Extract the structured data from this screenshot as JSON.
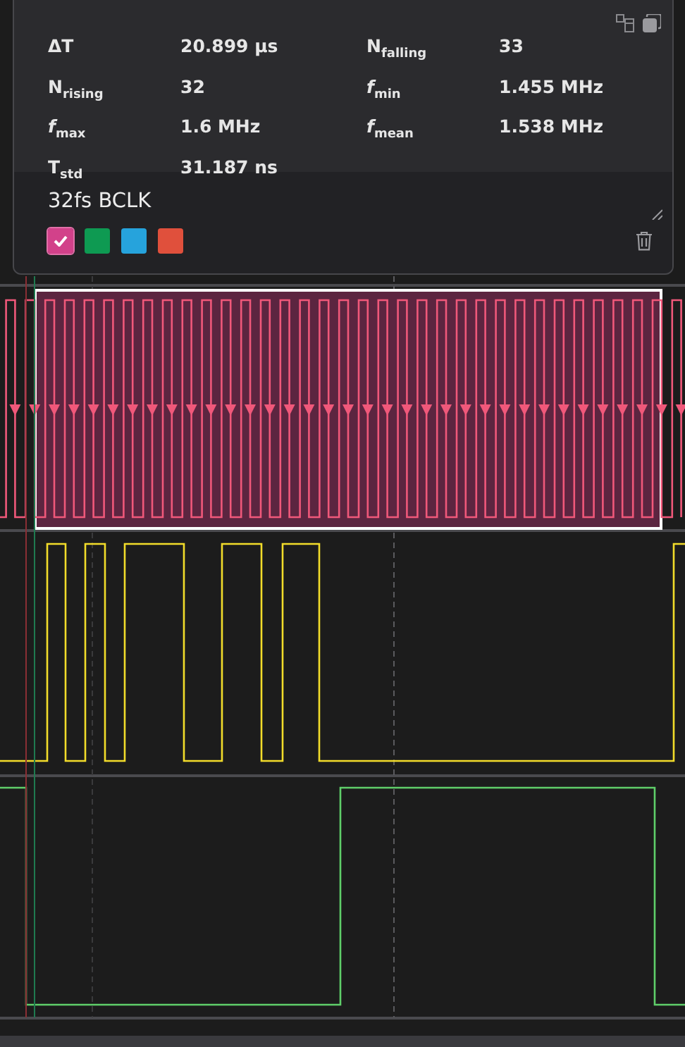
{
  "measurement": {
    "stats": [
      {
        "label": "ΔT",
        "value": "20.899 µs"
      },
      {
        "label": "N$_{falling}$",
        "value": "33"
      },
      {
        "label": "N$_{rising}$",
        "value": "32"
      },
      {
        "label": "*f*$_{min}$",
        "value": "1.455 MHz"
      },
      {
        "label": "*f*$_{max}$",
        "value": "1.6 MHz"
      },
      {
        "label": "*f*$_{mean}$",
        "value": "1.538 MHz"
      },
      {
        "label": "T$_{std}$",
        "value": "31.187 ns"
      }
    ],
    "note": "32fs BCLK",
    "swatches": [
      {
        "color": "#d2418a",
        "selected": true
      },
      {
        "color": "#0e9a52",
        "selected": false
      },
      {
        "color": "#26a3dc",
        "selected": false
      },
      {
        "color": "#e0503c",
        "selected": false
      }
    ]
  }
}
